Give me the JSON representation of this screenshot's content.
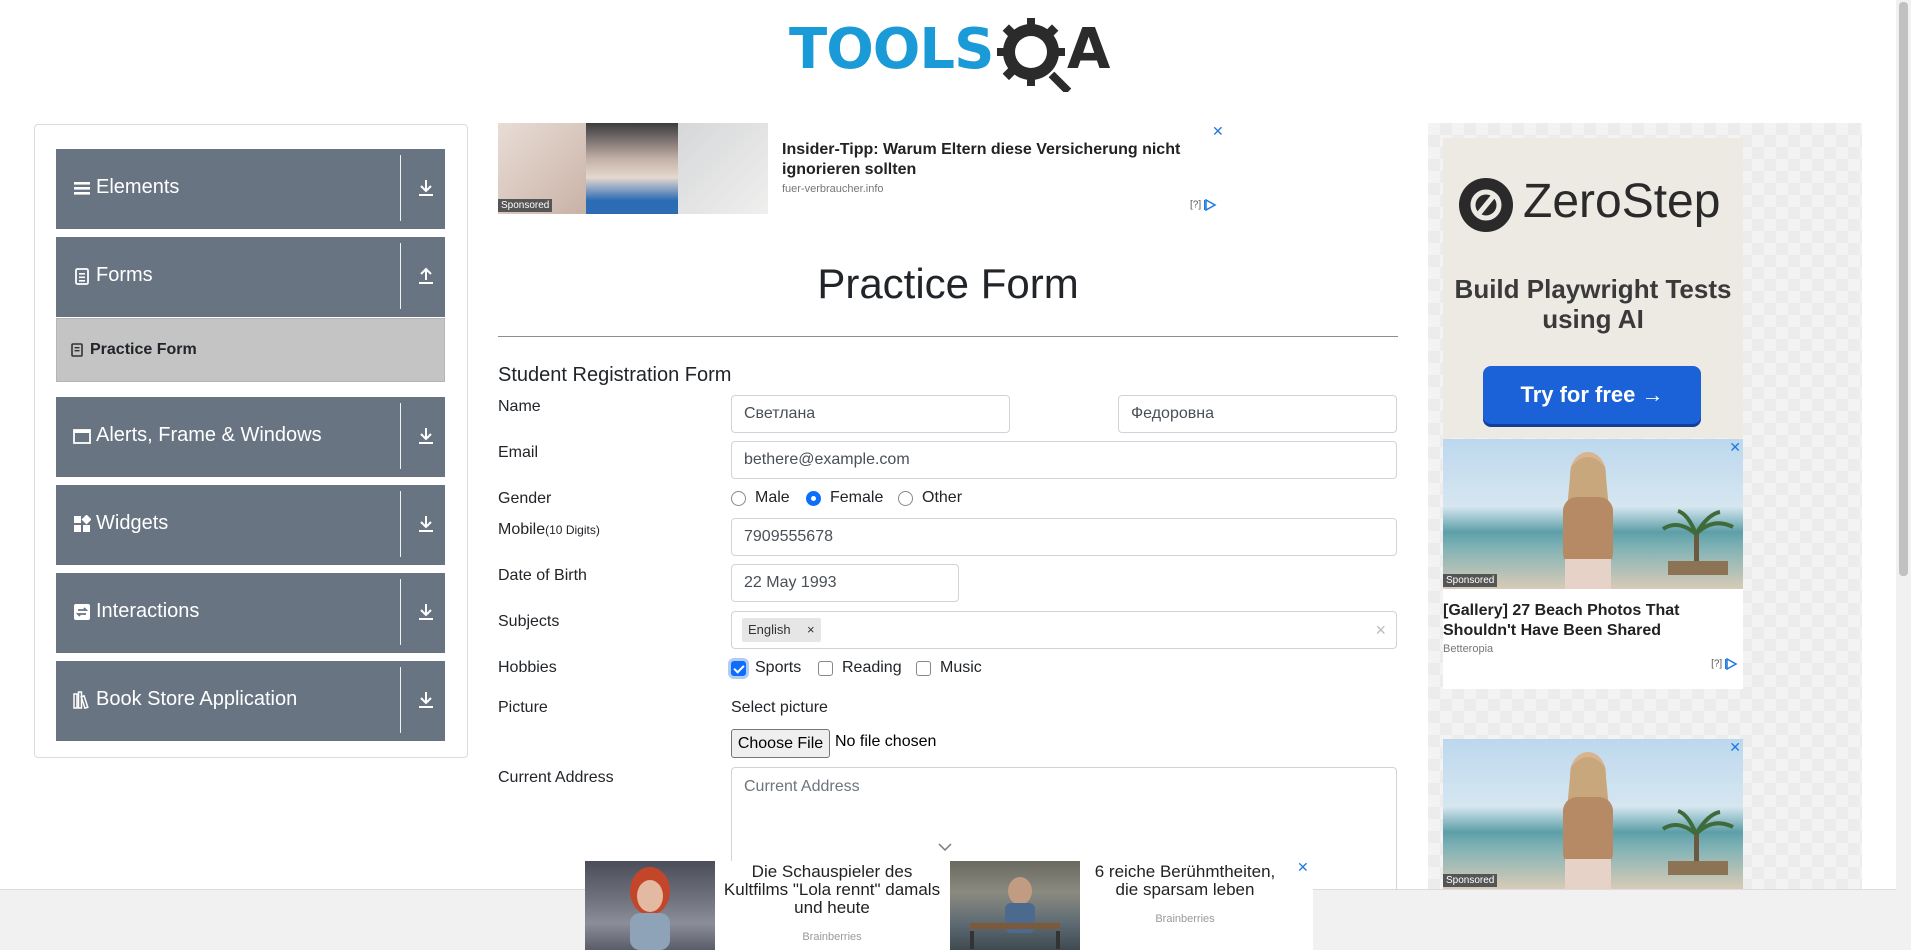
{
  "logo": {
    "text_main": "TOOLS",
    "text_end": "A"
  },
  "sidebar": {
    "groups": [
      {
        "label": "Elements",
        "icon": "menu-icon",
        "arrow": "download-icon"
      },
      {
        "label": "Forms",
        "icon": "document-icon",
        "arrow": "upload-icon"
      },
      {
        "label": "Alerts, Frame & Windows",
        "icon": "window-icon",
        "arrow": "download-icon"
      },
      {
        "label": "Widgets",
        "icon": "widgets-icon",
        "arrow": "download-icon"
      },
      {
        "label": "Interactions",
        "icon": "interactions-icon",
        "arrow": "download-icon"
      },
      {
        "label": "Book Store Application",
        "icon": "library-icon",
        "arrow": "download-icon"
      }
    ],
    "active_item": "Practice Form"
  },
  "top_ad": {
    "title": "Insider-Tipp: Warum Eltern diese Versicherung nicht ignorieren sollten",
    "domain": "fuer-verbraucher.info",
    "sponsored": "Sponsored",
    "close": "✕",
    "info": "[?]"
  },
  "form": {
    "page_title": "Practice Form",
    "heading": "Student Registration Form",
    "name_label": "Name",
    "first_name": "Светлана",
    "last_name": "Федоровна",
    "email_label": "Email",
    "email": "bethere@example.com",
    "gender_label": "Gender",
    "genders": [
      "Male",
      "Female",
      "Other"
    ],
    "gender_selected": "Female",
    "mobile_label": "Mobile",
    "mobile_hint": "(10 Digits)",
    "mobile": "7909555678",
    "dob_label": "Date of Birth",
    "dob": "22 May 1993",
    "subjects_label": "Subjects",
    "subject_chip": "English",
    "chip_remove": "×",
    "subjects_clear": "×",
    "hobbies_label": "Hobbies",
    "hobbies": [
      {
        "label": "Sports",
        "checked": true
      },
      {
        "label": "Reading",
        "checked": false
      },
      {
        "label": "Music",
        "checked": false
      }
    ],
    "picture_label": "Picture",
    "select_picture": "Select picture",
    "choose_file": "Choose File",
    "no_file": "No file chosen",
    "address_label": "Current Address",
    "address_placeholder": "Current Address"
  },
  "right_ad": {
    "brand": "ZeroStep",
    "tagline": "Build Playwright Tests using AI",
    "cta": "Try for free →",
    "beach_ads": [
      {
        "title": "[Gallery] 27 Beach Photos That Shouldn't Have Been Shared",
        "source": "Betteropia",
        "sponsored": "Sponsored",
        "info": "[?]",
        "close": "✕"
      },
      {
        "sponsored": "Sponsored",
        "close": "✕"
      }
    ]
  },
  "bottom_ad": {
    "item1_text": "Die Schauspieler des Kultfilms \"Lola rennt\" damals und heute",
    "item1_source": "Brainberries",
    "item2_text": "6 reiche Berühmtheiten, die sparsam leben",
    "item2_source": "Brainberries",
    "close": "✕"
  }
}
